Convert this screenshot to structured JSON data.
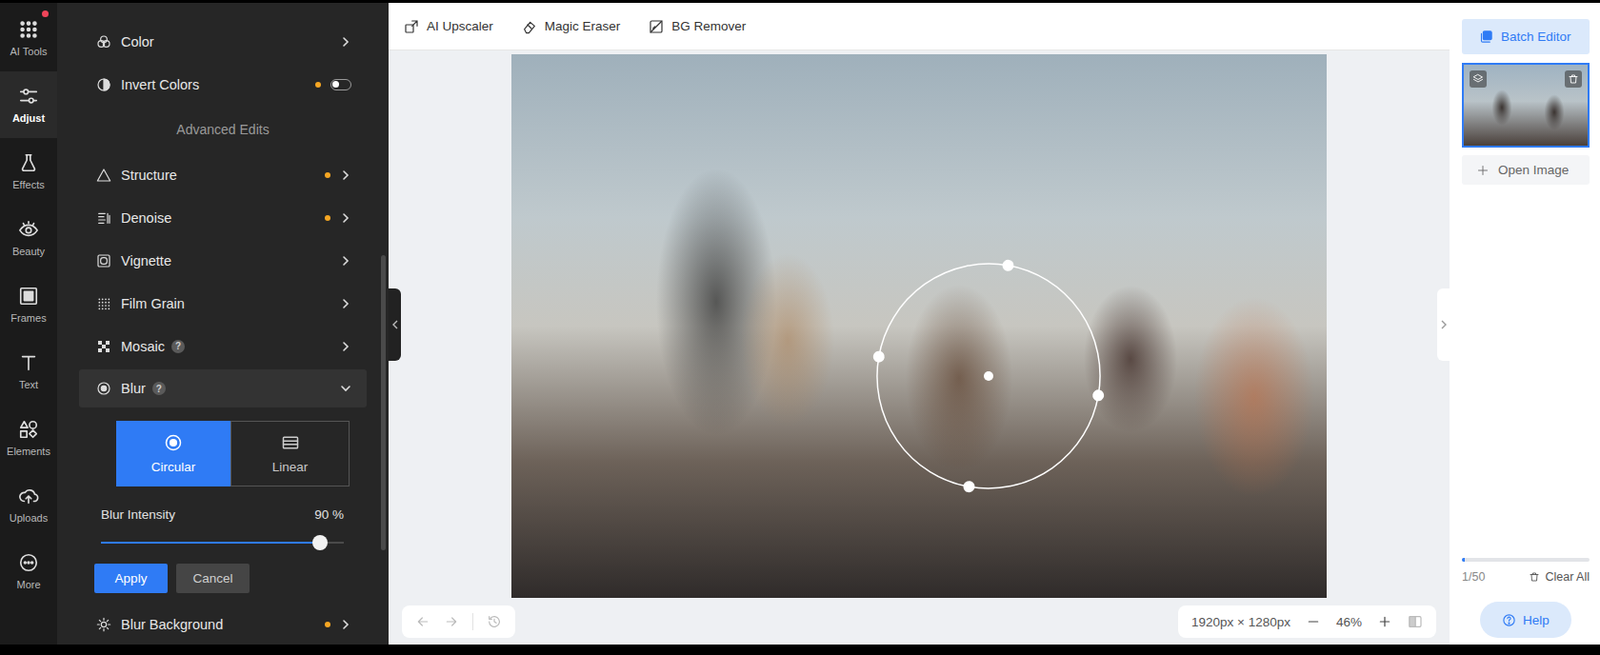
{
  "rail": [
    {
      "label": "AI Tools",
      "selected": false,
      "badge": true
    },
    {
      "label": "Adjust",
      "selected": true,
      "badge": false
    },
    {
      "label": "Effects",
      "selected": false,
      "badge": false
    },
    {
      "label": "Beauty",
      "selected": false,
      "badge": false
    },
    {
      "label": "Frames",
      "selected": false,
      "badge": false
    },
    {
      "label": "Text",
      "selected": false,
      "badge": false
    },
    {
      "label": "Elements",
      "selected": false,
      "badge": false
    },
    {
      "label": "Uploads",
      "selected": false,
      "badge": false
    },
    {
      "label": "More",
      "selected": false,
      "badge": false
    }
  ],
  "toolbar": [
    {
      "label": "AI Upscaler"
    },
    {
      "label": "Magic Eraser"
    },
    {
      "label": "BG Remover"
    }
  ],
  "panel": {
    "items": [
      {
        "kind": "row",
        "label": "Color",
        "modified": false
      },
      {
        "kind": "toggle",
        "label": "Invert Colors",
        "modified": true,
        "on": false
      },
      {
        "kind": "heading",
        "label": "Advanced Edits"
      },
      {
        "kind": "row",
        "label": "Structure",
        "modified": true
      },
      {
        "kind": "row",
        "label": "Denoise",
        "modified": true
      },
      {
        "kind": "row",
        "label": "Vignette",
        "modified": false
      },
      {
        "kind": "row",
        "label": "Film Grain",
        "modified": false
      },
      {
        "kind": "row",
        "label": "Mosaic",
        "modified": false,
        "help": "?"
      },
      {
        "kind": "blur",
        "label": "Blur",
        "modified": false,
        "help": "?",
        "expanded": true,
        "modes": [
          {
            "label": "Circular",
            "selected": true
          },
          {
            "label": "Linear",
            "selected": false
          }
        ],
        "intensity": {
          "label": "Blur Intensity",
          "reading": "90 %",
          "level": 0.9
        },
        "buttons": [
          {
            "label": "Apply",
            "primary": true
          },
          {
            "label": "Cancel",
            "primary": false
          }
        ]
      },
      {
        "kind": "row",
        "label": "Blur Background",
        "modified": true
      }
    ]
  },
  "canvas": {
    "size": "1920px × 1280px",
    "zoom": "46%"
  },
  "right": {
    "batch": "Batch Editor",
    "thumbnail_selected": true,
    "open": "Open Image",
    "progress": 0.02,
    "count": "1/50",
    "clear": "Clear All",
    "help": "Help"
  }
}
